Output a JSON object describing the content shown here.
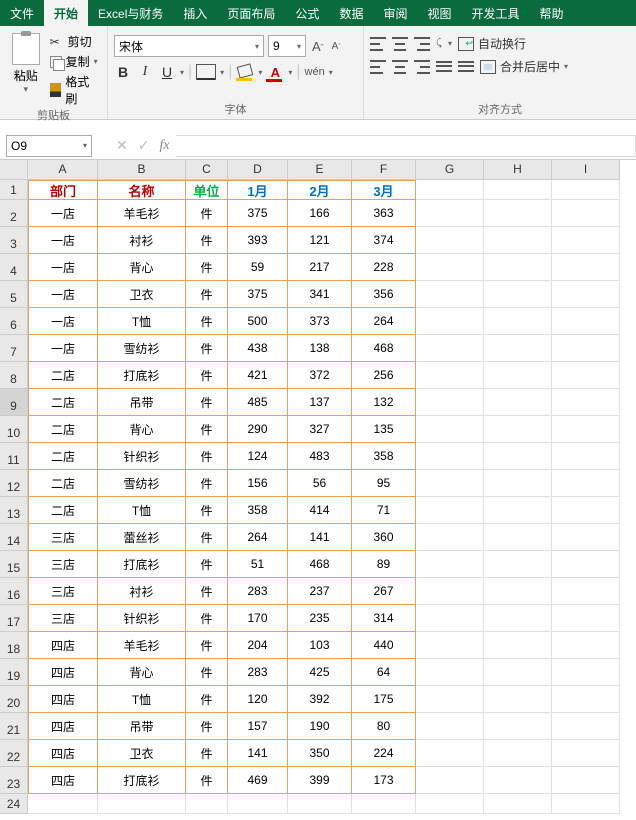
{
  "menu": {
    "file": "文件",
    "home": "开始",
    "excel_fin": "Excel与财务",
    "insert": "插入",
    "layout": "页面布局",
    "formula": "公式",
    "data": "数据",
    "review": "审阅",
    "view": "视图",
    "dev": "开发工具",
    "help": "帮助"
  },
  "ribbon": {
    "clipboard": {
      "paste": "粘贴",
      "cut": "剪切",
      "copy": "复制",
      "format_painter": "格式刷",
      "group": "剪贴板"
    },
    "font": {
      "name": "宋体",
      "size": "9",
      "group": "字体",
      "wen": "wén"
    },
    "align": {
      "wrap": "自动换行",
      "merge": "合并后居中",
      "group": "对齐方式"
    }
  },
  "namebox": "O9",
  "columns": [
    "A",
    "B",
    "C",
    "D",
    "E",
    "F",
    "G",
    "H",
    "I"
  ],
  "selected_row": 9,
  "chart_data": {
    "type": "table",
    "headers": [
      "部门",
      "名称",
      "单位",
      "1月",
      "2月",
      "3月"
    ],
    "rows": [
      [
        "一店",
        "羊毛衫",
        "件",
        375,
        166,
        363
      ],
      [
        "一店",
        "衬衫",
        "件",
        393,
        121,
        374
      ],
      [
        "一店",
        "背心",
        "件",
        59,
        217,
        228
      ],
      [
        "一店",
        "卫衣",
        "件",
        375,
        341,
        356
      ],
      [
        "一店",
        "T恤",
        "件",
        500,
        373,
        264
      ],
      [
        "一店",
        "雪纺衫",
        "件",
        438,
        138,
        468
      ],
      [
        "二店",
        "打底衫",
        "件",
        421,
        372,
        256
      ],
      [
        "二店",
        "吊带",
        "件",
        485,
        137,
        132
      ],
      [
        "二店",
        "背心",
        "件",
        290,
        327,
        135
      ],
      [
        "二店",
        "针织衫",
        "件",
        124,
        483,
        358
      ],
      [
        "二店",
        "雪纺衫",
        "件",
        156,
        56,
        95
      ],
      [
        "二店",
        "T恤",
        "件",
        358,
        414,
        71
      ],
      [
        "三店",
        "蕾丝衫",
        "件",
        264,
        141,
        360
      ],
      [
        "三店",
        "打底衫",
        "件",
        51,
        468,
        89
      ],
      [
        "三店",
        "衬衫",
        "件",
        283,
        237,
        267
      ],
      [
        "三店",
        "针织衫",
        "件",
        170,
        235,
        314
      ],
      [
        "四店",
        "羊毛衫",
        "件",
        204,
        103,
        440
      ],
      [
        "四店",
        "背心",
        "件",
        283,
        425,
        64
      ],
      [
        "四店",
        "T恤",
        "件",
        120,
        392,
        175
      ],
      [
        "四店",
        "吊带",
        "件",
        157,
        190,
        80
      ],
      [
        "四店",
        "卫衣",
        "件",
        141,
        350,
        224
      ],
      [
        "四店",
        "打底衫",
        "件",
        469,
        399,
        173
      ]
    ]
  },
  "row_heights": {
    "header": 20,
    "data": 27,
    "empty": 20
  },
  "total_rows": 24
}
